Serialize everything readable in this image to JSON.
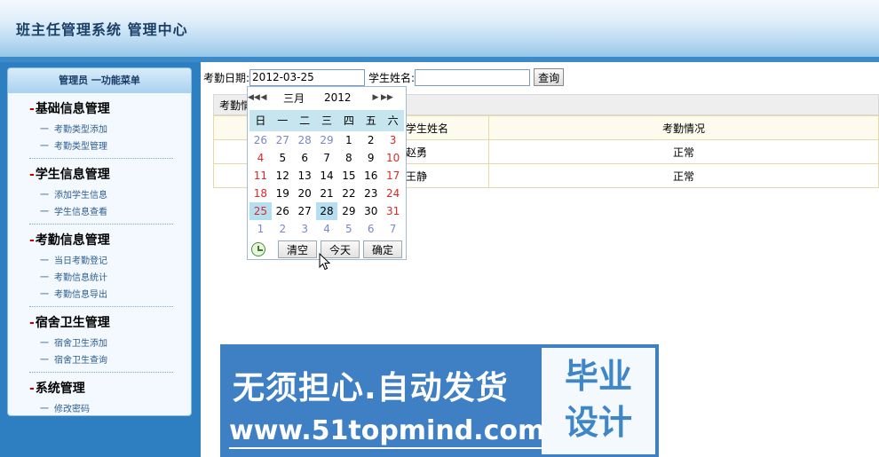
{
  "header": {
    "title": "班主任管理系统  管理中心"
  },
  "menu": {
    "head": "管理员  一功能菜单",
    "groups": [
      {
        "title": "基础信息管理",
        "items": [
          "考勤类型添加",
          "考勤类型管理"
        ]
      },
      {
        "title": "学生信息管理",
        "items": [
          "添加学生信息",
          "学生信息查看"
        ]
      },
      {
        "title": "考勤信息管理",
        "items": [
          "当日考勤登记",
          "考勤信息统计",
          "考勤信息导出"
        ]
      },
      {
        "title": "宿舍卫生管理",
        "items": [
          "宿舍卫生添加",
          "宿舍卫生查询"
        ]
      },
      {
        "title": "系统管理",
        "items": [
          "修改密码"
        ]
      }
    ],
    "item_dash": "一"
  },
  "search": {
    "date_label": "考勤日期:",
    "date_value": "2012-03-25",
    "name_label": "学生姓名:",
    "name_value": "",
    "query_button": "查询"
  },
  "table": {
    "caption": "考勤情",
    "headers": [
      "",
      "学生姓名",
      "考勤情况"
    ],
    "rows": [
      [
        "",
        "赵勇",
        "正常"
      ],
      [
        "",
        "王静",
        "正常"
      ]
    ]
  },
  "calendar": {
    "month": "三月",
    "year": "2012",
    "weekdays": [
      "日",
      "一",
      "二",
      "三",
      "四",
      "五",
      "六"
    ],
    "weeks": [
      [
        "26",
        "27",
        "28",
        "29",
        "1",
        "2",
        "3"
      ],
      [
        "4",
        "5",
        "6",
        "7",
        "8",
        "9",
        "10"
      ],
      [
        "11",
        "12",
        "13",
        "14",
        "15",
        "16",
        "17"
      ],
      [
        "18",
        "19",
        "20",
        "21",
        "22",
        "23",
        "24"
      ],
      [
        "25",
        "26",
        "27",
        "28",
        "29",
        "30",
        "31"
      ],
      [
        "1",
        "2",
        "3",
        "4",
        "5",
        "6",
        "7"
      ]
    ],
    "selected": "25",
    "today": "28",
    "buttons": {
      "clear": "清空",
      "today": "今天",
      "ok": "确定"
    }
  },
  "ad": {
    "headline": "无须担心.自动发货",
    "url": "www.51topmind.com",
    "box_line1": "毕业",
    "box_line2": "设计"
  }
}
